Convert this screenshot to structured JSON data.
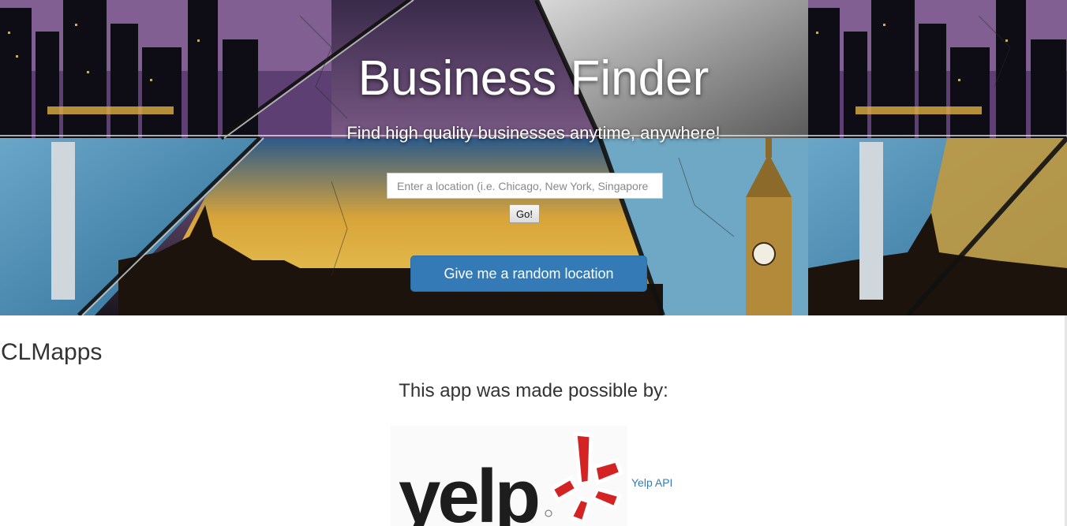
{
  "hero": {
    "title": "Business Finder",
    "subtitle": "Find high quality businesses anytime, anywhere!"
  },
  "search": {
    "placeholder": "Enter a location (i.e. Chicago, New York, Singapore",
    "value": "",
    "go_label": "Go!"
  },
  "random_button_label": "Give me a random location",
  "brand": "CLMapps",
  "credit_text": "This app was made possible by:",
  "yelp": {
    "logo_text": "yelp",
    "link_text": "Yelp API",
    "brand_color": "#d32323"
  },
  "colors": {
    "primary_button": "#337ab7",
    "link": "#337ab7",
    "text": "#333333"
  }
}
